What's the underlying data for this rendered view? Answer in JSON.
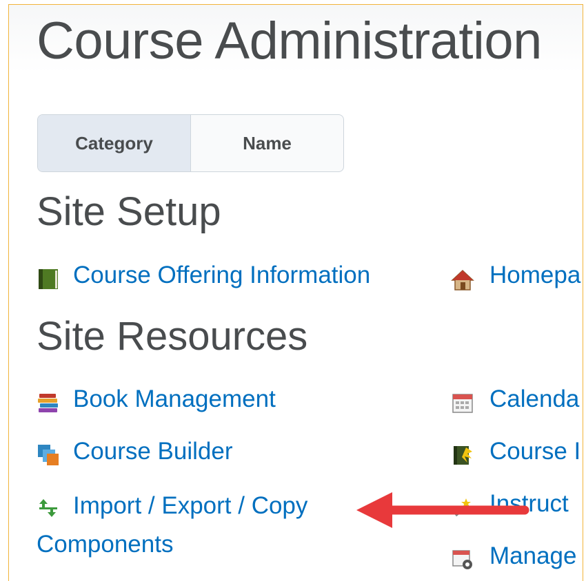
{
  "page": {
    "title": "Course Administration"
  },
  "view_toggle": {
    "category_label": "Category",
    "name_label": "Name",
    "selected": "Category"
  },
  "sections": [
    {
      "heading": "Site Setup",
      "tools": [
        {
          "label": "Course Offering Information",
          "icon": "book-icon"
        },
        {
          "label": "Homepa",
          "icon": "house-icon"
        }
      ]
    },
    {
      "heading": "Site Resources",
      "tools": [
        {
          "label": "Book Management",
          "icon": "books-icon"
        },
        {
          "label": "Calenda",
          "icon": "calendar-icon"
        },
        {
          "label": "Course Builder",
          "icon": "course-builder-icon"
        },
        {
          "label": "Course I",
          "icon": "course-package-icon"
        },
        {
          "label": "Import / Export / Copy Components",
          "icon": "import-export-icon"
        },
        {
          "label": "Instruct",
          "icon": "magic-wand-icon"
        },
        {
          "label": "Manage",
          "icon": "calendar-gear-icon"
        }
      ]
    }
  ],
  "annotation": {
    "arrow_color": "#e8393b",
    "points_to": "Import / Export / Copy Components"
  },
  "colors": {
    "link": "#006fbf",
    "heading": "#494c4e",
    "frame_border": "#f2b43a",
    "toggle_active": "#e3e9f1"
  }
}
